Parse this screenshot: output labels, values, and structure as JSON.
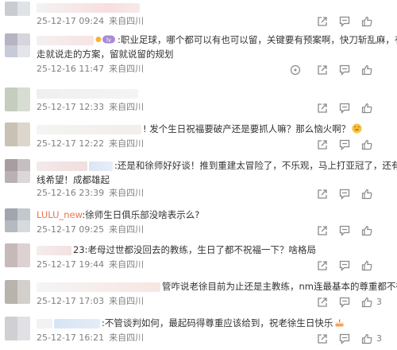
{
  "comments": [
    {
      "text": "",
      "time": "25-12-17 09:24",
      "source": "来自四川",
      "likes": "",
      "has_more": false
    },
    {
      "text": ":职业足球，哪个都可以有也可以留，关键要有预案啊，快刀斩乱麻，有",
      "text2": "走就说走的方案，留就说留的规划",
      "time": "25-12-16 11:47",
      "source": "来自四川",
      "likes": "",
      "has_more": true
    },
    {
      "text": "",
      "time": "25-12-17 12:33",
      "source": "来自四川",
      "likes": "",
      "has_more": false
    },
    {
      "text": "! 发个生日祝福要破产还是要抓人嘛？那么恼火啊？",
      "time": "25-12-17 12:22",
      "source": "来自四川",
      "likes": "",
      "has_more": false
    },
    {
      "text": ":还是和徐师好好谈！推到重建太冒险了，不乐观，马上打亚冠了，还有出",
      "text2": "线希望！成都雄起",
      "time": "25-12-16 23:39",
      "source": "来自四川",
      "likes": "",
      "has_more": false
    },
    {
      "username": "LULU_new",
      "text": ":徐师生日俱乐部没啥表示么?",
      "time": "25-12-17 09:25",
      "source": "来自四川",
      "likes": "",
      "has_more": false
    },
    {
      "text": "23:老母过世都没回去的教练，生日了都不祝福一下？啥格局",
      "time": "25-12-17 19:44",
      "source": "来自四川",
      "likes": "",
      "has_more": false
    },
    {
      "text": "管咋说老徐目前为止还是主教练，nm连最基本的尊重都不得",
      "time": "25-12-17 17:03",
      "source": "来自四川",
      "likes": "3",
      "has_more": false
    },
    {
      "text": ":不管谈判如何，最起码得尊重应该给到，祝老徐生日快乐",
      "time": "25-12-17 16:21",
      "source": "来自四川",
      "likes": "3",
      "has_more": false
    }
  ],
  "icons": {
    "share": "share-icon",
    "comment": "comment-icon",
    "like": "thumbs-up-icon",
    "more": "more-icon"
  },
  "colors": {
    "meta": "#808080",
    "username": "#eb7350",
    "icon": "#8a8a8a"
  }
}
